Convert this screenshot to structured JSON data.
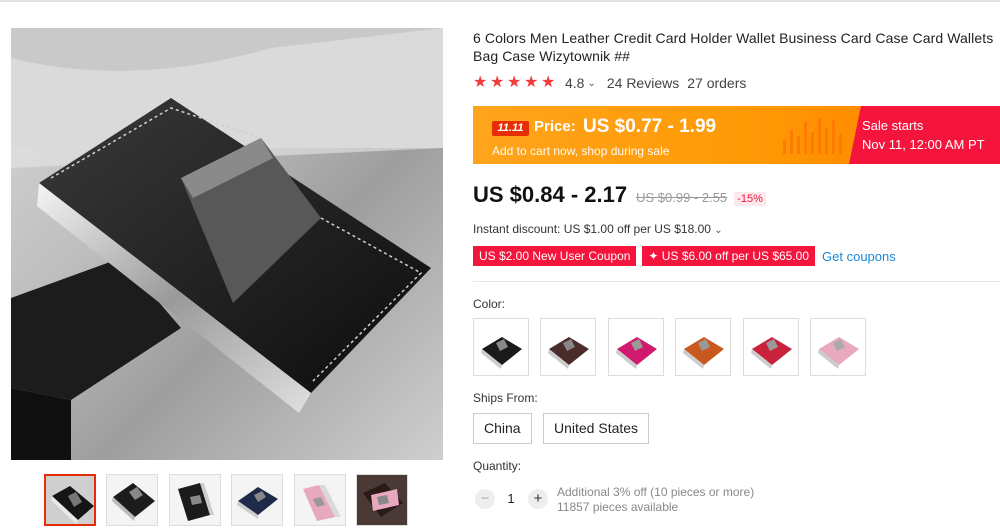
{
  "product": {
    "title": "6 Colors Men Leather Credit Card Holder Wallet Business Card Case Card Wallets Bag Case Wizytownik ##",
    "rating": "4.8",
    "reviews": "24 Reviews",
    "orders": "27 orders",
    "main_image_icon": "card-holder-image",
    "thumbnail_count": 6
  },
  "promo": {
    "badge": "11.11",
    "price_label": "Price:",
    "price_value": "US $0.77 - 1.99",
    "subtext": "Add to cart now, shop during sale",
    "sale_title": "Sale starts",
    "sale_date": "Nov 11, 12:00 AM PT"
  },
  "pricing": {
    "current": "US $0.84 - 2.17",
    "original": "US $0.99 - 2.55",
    "discount": "-15%",
    "instant_discount": "Instant discount: US $1.00 off per US $18.00"
  },
  "coupons": {
    "coupon1": "US $2.00 New User Coupon",
    "coupon2": "✦ US $6.00 off per US $65.00",
    "get_coupons": "Get coupons"
  },
  "options": {
    "color_label": "Color:",
    "colors": [
      "#1a1a1a",
      "#4a2c2a",
      "#d01a6e",
      "#c8581e",
      "#c8223c",
      "#e8a8bd"
    ],
    "ships_label": "Ships From:",
    "ships": [
      "China",
      "United States"
    ]
  },
  "quantity": {
    "label": "Quantity:",
    "value": "1",
    "minus": "−",
    "plus": "+",
    "note1": "Additional 3% off (10 pieces or more)",
    "note2": "11857 pieces available"
  },
  "colors": {
    "accent": "#e62e04",
    "sale_red": "#f5143c",
    "sale_orange": "#ff9800",
    "link": "#1a88d6"
  }
}
